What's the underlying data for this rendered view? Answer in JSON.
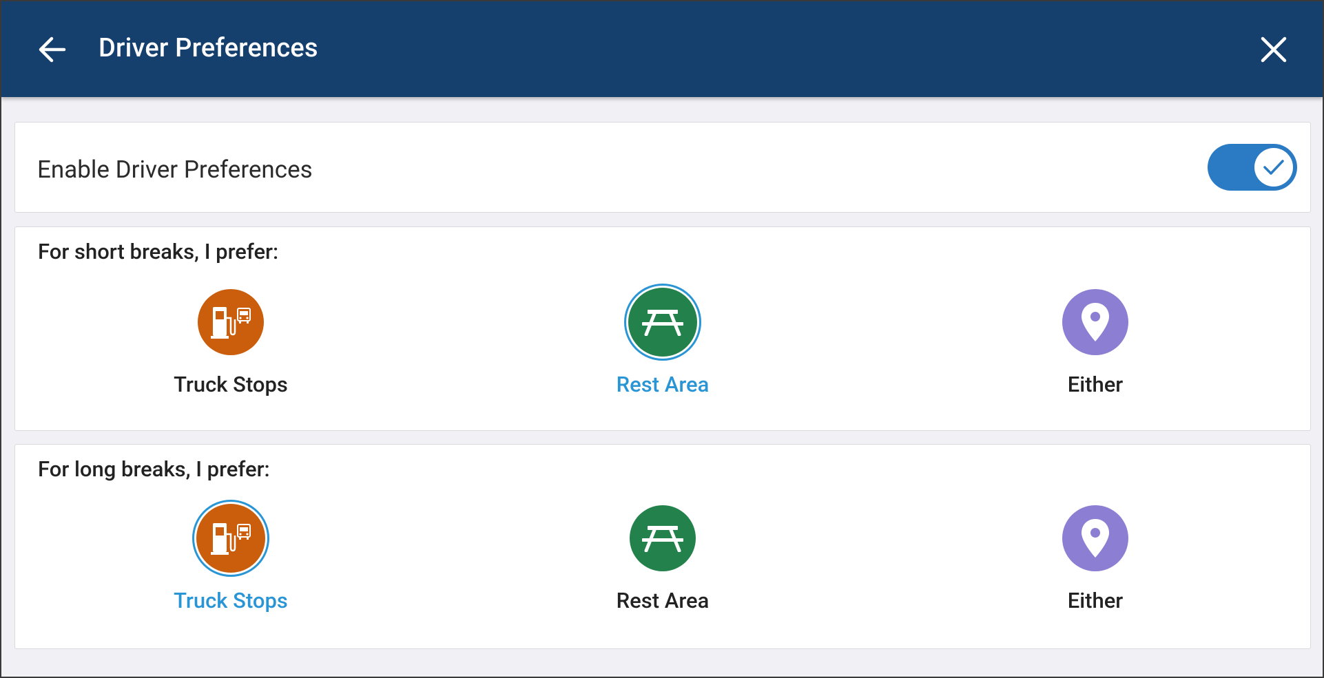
{
  "header": {
    "title": "Driver Preferences",
    "back_icon": "arrow-left-icon",
    "close_icon": "close-icon"
  },
  "enable": {
    "label": "Enable Driver Preferences",
    "toggle_on": true
  },
  "short_breaks": {
    "title": "For short breaks, I prefer:",
    "selected": "Rest Area",
    "options": [
      {
        "label": "Truck Stops",
        "icon": "fuel-pump-icon"
      },
      {
        "label": "Rest Area",
        "icon": "picnic-table-icon"
      },
      {
        "label": "Either",
        "icon": "location-pin-icon"
      }
    ]
  },
  "long_breaks": {
    "title": "For long breaks, I prefer:",
    "selected": "Truck Stops",
    "options": [
      {
        "label": "Truck Stops",
        "icon": "fuel-pump-icon"
      },
      {
        "label": "Rest Area",
        "icon": "picnic-table-icon"
      },
      {
        "label": "Either",
        "icon": "location-pin-icon"
      }
    ]
  },
  "colors": {
    "header_bg": "#153f6d",
    "accent": "#2a95d5",
    "truck_stop": "#cb5e0c",
    "rest_area": "#23814b",
    "either": "#8c7ed3"
  }
}
